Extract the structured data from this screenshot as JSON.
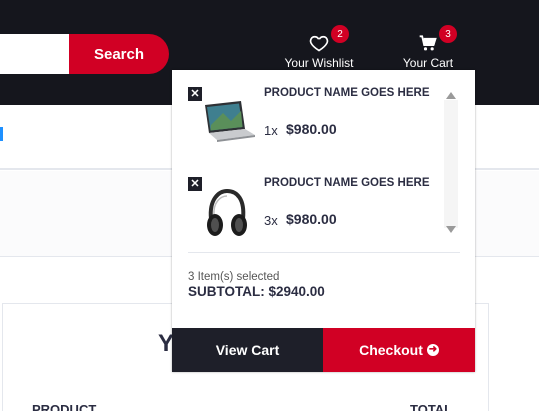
{
  "header": {
    "search_button": "Search",
    "wishlist": {
      "label": "Your Wishlist",
      "count": "2"
    },
    "cart": {
      "label": "Your Cart",
      "count": "3"
    }
  },
  "page": {
    "order_title_fragment": "Y",
    "columns": {
      "product": "PRODUCT",
      "total": "TOTAL"
    }
  },
  "cart_dropdown": {
    "items": [
      {
        "name": "PRODUCT NAME GOES HERE",
        "qty": "1x",
        "price": "$980.00",
        "image": "laptop-icon"
      },
      {
        "name": "PRODUCT NAME GOES HERE",
        "qty": "3x",
        "price": "$980.00",
        "image": "headphones-icon"
      }
    ],
    "summary": {
      "count_text": "3 Item(s) selected",
      "subtotal_text": "SUBTOTAL: $2940.00"
    },
    "buttons": {
      "view_cart": "View Cart",
      "checkout": "Checkout"
    }
  },
  "colors": {
    "accent": "#d10024",
    "dark": "#15161d",
    "button_dark": "#1e1f29"
  }
}
